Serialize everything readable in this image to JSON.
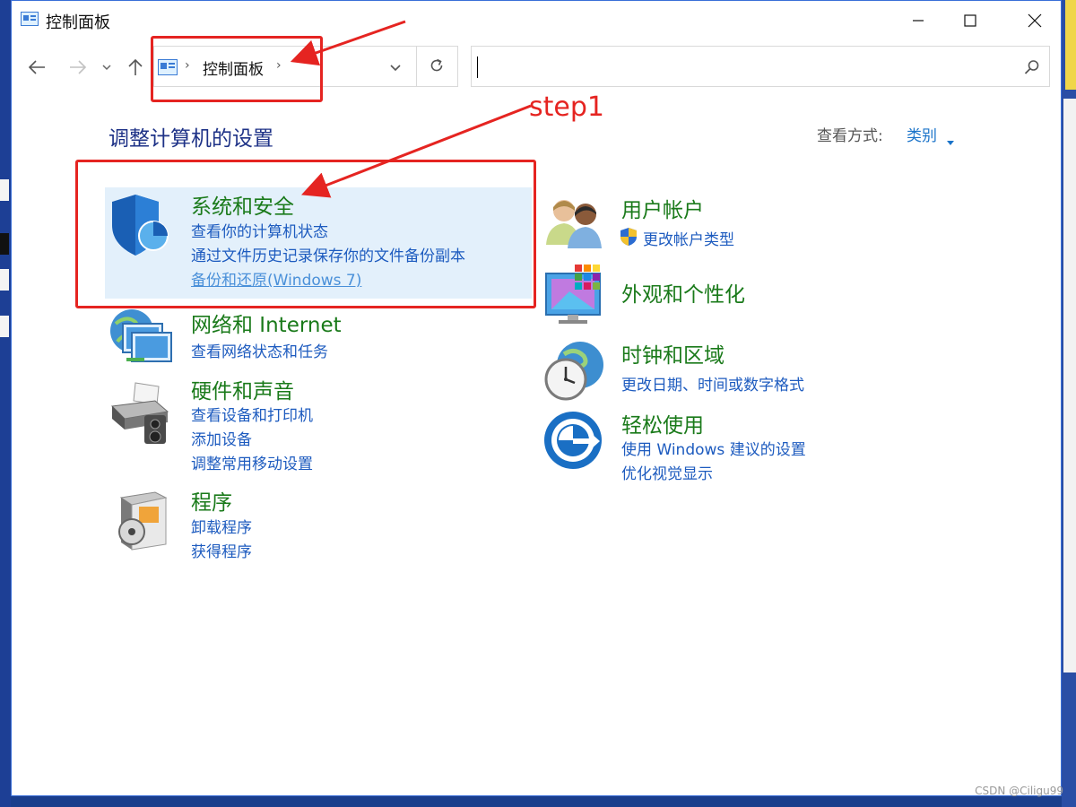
{
  "window": {
    "title": "控制面板"
  },
  "breadcrumb": {
    "item": "控制面板"
  },
  "search": {
    "value": "",
    "placeholder": ""
  },
  "heading": "调整计算机的设置",
  "view": {
    "label": "查看方式:",
    "value": "类别"
  },
  "categories": {
    "system": {
      "title": "系统和安全",
      "links": [
        "查看你的计算机状态",
        "通过文件历史记录保存你的文件备份副本",
        "备份和还原(Windows 7)"
      ]
    },
    "network": {
      "title": "网络和 Internet",
      "links": [
        "查看网络状态和任务"
      ]
    },
    "hardware": {
      "title": "硬件和声音",
      "links": [
        "查看设备和打印机",
        "添加设备",
        "调整常用移动设置"
      ]
    },
    "programs": {
      "title": "程序",
      "links": [
        "卸载程序",
        "获得程序"
      ]
    },
    "users": {
      "title": "用户帐户",
      "links": [
        "更改帐户类型"
      ]
    },
    "appearance": {
      "title": "外观和个性化",
      "links": []
    },
    "clock": {
      "title": "时钟和区域",
      "links": [
        "更改日期、时间或数字格式"
      ]
    },
    "ease": {
      "title": "轻松使用",
      "links": [
        "使用 Windows 建议的设置",
        "优化视觉显示"
      ]
    }
  },
  "annotation": {
    "label": "step1",
    "color": "#e52421"
  },
  "watermark": "CSDN @Ciligu99",
  "colors": {
    "category_title": "#1a7a1a",
    "link": "#1d5bbf",
    "heading": "#1e3287",
    "highlight": "#e3f0fb"
  }
}
